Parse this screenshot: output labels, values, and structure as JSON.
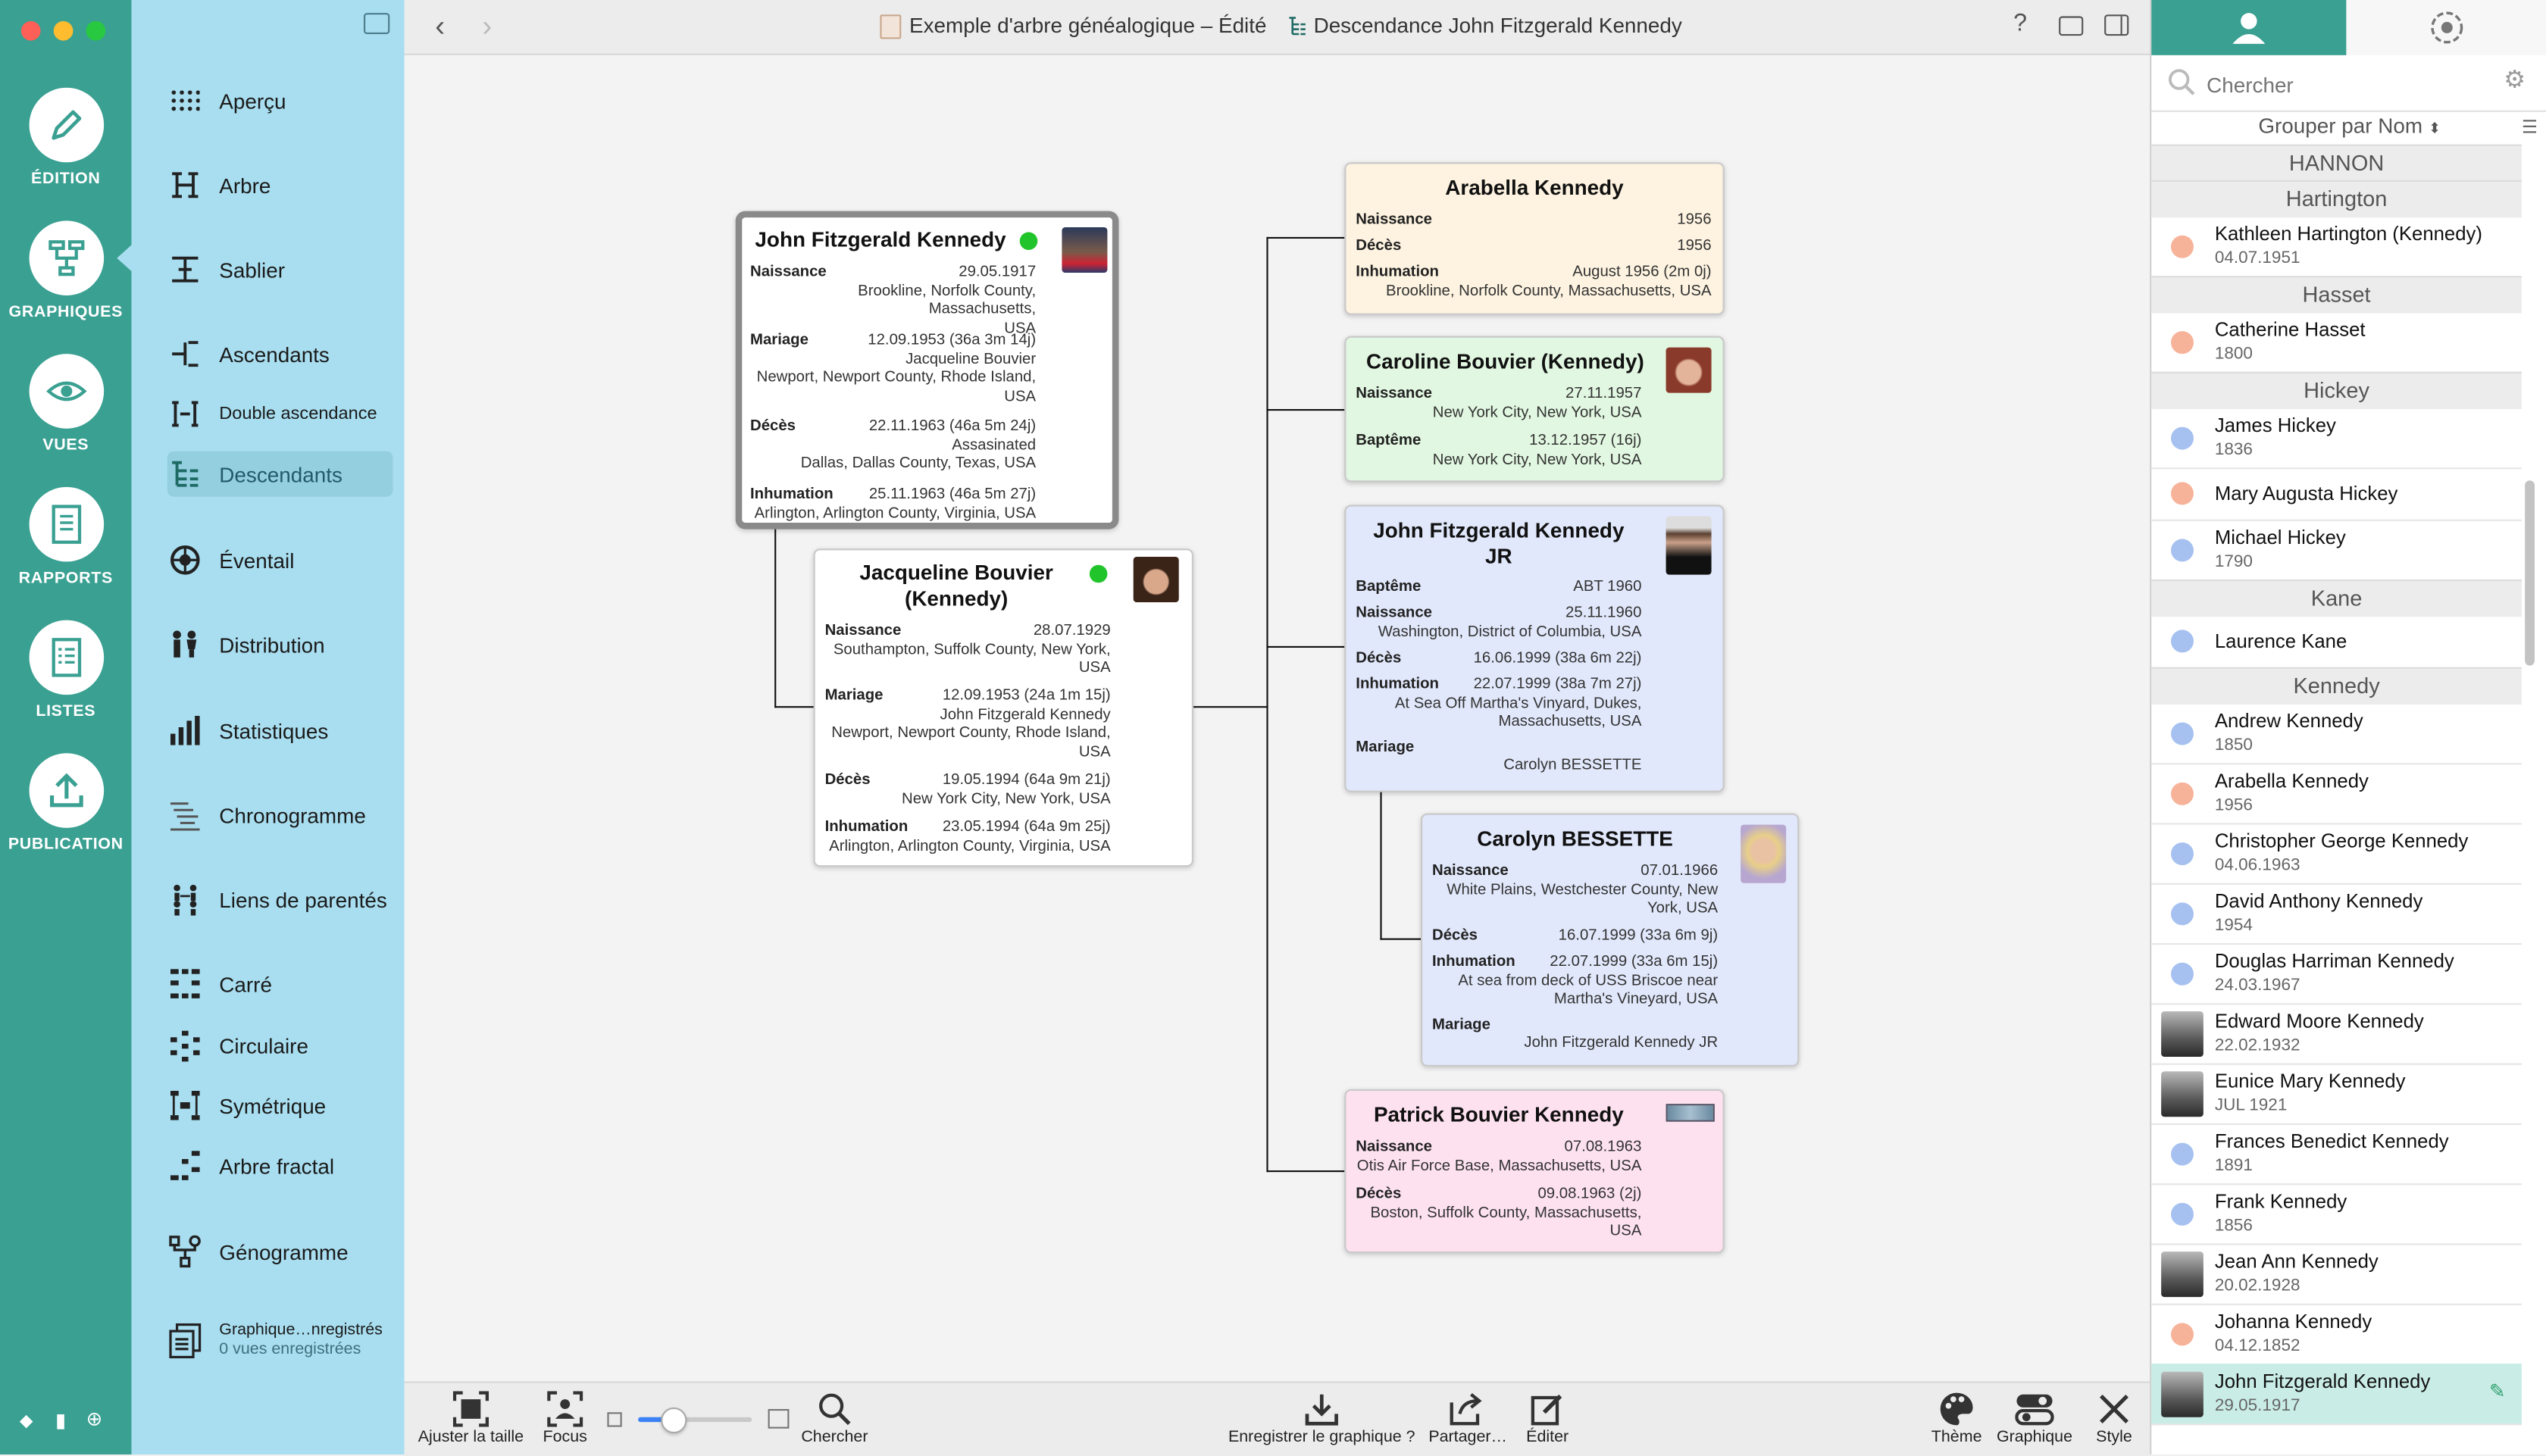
{
  "colors": {
    "rail": "#3aa092",
    "sidebar": "#a8def0",
    "dot_green": "#22c42b",
    "dot_blue": "#a6c1f0",
    "dot_orange": "#f7b39a"
  },
  "rail": {
    "items": [
      {
        "label": "ÉDITION",
        "icon": "pencil-icon"
      },
      {
        "label": "GRAPHIQUES",
        "icon": "chart-icon"
      },
      {
        "label": "VUES",
        "icon": "eye-icon"
      },
      {
        "label": "RAPPORTS",
        "icon": "report-icon"
      },
      {
        "label": "LISTES",
        "icon": "list-icon"
      },
      {
        "label": "PUBLICATION",
        "icon": "upload-icon"
      }
    ]
  },
  "sidebar": {
    "items": [
      {
        "label": "Aperçu"
      },
      {
        "label": "Arbre"
      },
      {
        "label": "Sablier"
      },
      {
        "label": "Ascendants"
      },
      {
        "label": "Double ascendance"
      },
      {
        "label": "Descendants"
      },
      {
        "label": "Éventail"
      },
      {
        "label": "Distribution"
      },
      {
        "label": "Statistiques"
      },
      {
        "label": "Chronogramme"
      },
      {
        "label": "Liens de parentés"
      },
      {
        "label": "Carré"
      },
      {
        "label": "Circulaire"
      },
      {
        "label": "Symétrique"
      },
      {
        "label": "Arbre fractal"
      },
      {
        "label": "Génogramme"
      }
    ],
    "saved": {
      "title": "Graphique…nregistrés",
      "subtitle": "0 vues enregistrées"
    }
  },
  "titlebar": {
    "document": "Exemple d'arbre généalogique – Édité",
    "chart": "Descendance John Fitzgerald Kennedy"
  },
  "toolbar": {
    "fit": "Ajuster la taille",
    "focus": "Focus",
    "search": "Chercher",
    "save": "Enregistrer le graphique ?",
    "share": "Partager…",
    "edit": "Éditer",
    "theme": "Thème",
    "chart": "Graphique",
    "style": "Style",
    "zoom_level": 0.3
  },
  "cards": {
    "jfk": {
      "name": "John Fitzgerald Kennedy",
      "events": [
        {
          "label": "Naissance",
          "lines": [
            "29.05.1917",
            "Brookline, Norfolk County, Massachusetts,",
            "USA"
          ]
        },
        {
          "label": "Mariage",
          "lines": [
            "12.09.1953 (36a 3m 14j)",
            "Jacqueline Bouvier",
            "Newport, Newport County, Rhode Island,",
            "USA"
          ]
        },
        {
          "label": "Décès",
          "lines": [
            "22.11.1963 (46a 5m 24j)",
            "Assasinated",
            "Dallas, Dallas County, Texas, USA"
          ]
        },
        {
          "label": "Inhumation",
          "lines": [
            "25.11.1963 (46a 5m 27j)",
            "Arlington, Arlington County, Virginia, USA"
          ]
        }
      ]
    },
    "jackie": {
      "name": "Jacqueline Bouvier (Kennedy)",
      "events": [
        {
          "label": "Naissance",
          "lines": [
            "28.07.1929",
            "Southampton, Suffolk County, New York,",
            "USA"
          ]
        },
        {
          "label": "Mariage",
          "lines": [
            "12.09.1953 (24a 1m 15j)",
            "John Fitzgerald Kennedy",
            "Newport, Newport County, Rhode Island,",
            "USA"
          ]
        },
        {
          "label": "Décès",
          "lines": [
            "19.05.1994 (64a 9m 21j)",
            "New York City, New York, USA"
          ]
        },
        {
          "label": "Inhumation",
          "lines": [
            "23.05.1994 (64a 9m 25j)",
            "Arlington, Arlington County, Virginia, USA"
          ]
        }
      ]
    },
    "arabella": {
      "name": "Arabella Kennedy",
      "events": [
        {
          "label": "Naissance",
          "lines": [
            "1956"
          ]
        },
        {
          "label": "Décès",
          "lines": [
            "1956"
          ]
        },
        {
          "label": "Inhumation",
          "lines": [
            "August 1956 (2m 0j)",
            "Brookline, Norfolk County, Massachusetts, USA"
          ]
        }
      ]
    },
    "caroline": {
      "name": "Caroline Bouvier (Kennedy)",
      "events": [
        {
          "label": "Naissance",
          "lines": [
            "27.11.1957",
            "New York City, New York, USA"
          ]
        },
        {
          "label": "Baptême",
          "lines": [
            "13.12.1957 (16j)",
            "New York City, New York, USA"
          ]
        }
      ]
    },
    "jfkjr": {
      "name": "John Fitzgerald Kennedy JR",
      "events": [
        {
          "label": "Baptême",
          "lines": [
            "ABT 1960"
          ]
        },
        {
          "label": "Naissance",
          "lines": [
            "25.11.1960",
            "Washington, District of Columbia, USA"
          ]
        },
        {
          "label": "Décès",
          "lines": [
            "16.06.1999 (38a 6m 22j)"
          ]
        },
        {
          "label": "Inhumation",
          "lines": [
            "22.07.1999 (38a 7m 27j)",
            "At Sea Off Martha's Vinyard, Dukes,",
            "Massachusetts, USA"
          ]
        },
        {
          "label": "Mariage",
          "lines": [
            "",
            "Carolyn BESSETTE"
          ]
        }
      ]
    },
    "carolyn": {
      "name": "Carolyn BESSETTE",
      "events": [
        {
          "label": "Naissance",
          "lines": [
            "07.01.1966",
            "White Plains, Westchester County, New",
            "York, USA"
          ]
        },
        {
          "label": "Décès",
          "lines": [
            "16.07.1999 (33a 6m 9j)"
          ]
        },
        {
          "label": "Inhumation",
          "lines": [
            "22.07.1999 (33a 6m 15j)",
            "At sea from deck of USS Briscoe near",
            "Martha's Vineyard, USA"
          ]
        },
        {
          "label": "Mariage",
          "lines": [
            "",
            "John Fitzgerald Kennedy JR"
          ]
        }
      ]
    },
    "patrick": {
      "name": "Patrick Bouvier Kennedy",
      "events": [
        {
          "label": "Naissance",
          "lines": [
            "07.08.1963",
            "Otis Air Force Base, Massachusetts, USA"
          ]
        },
        {
          "label": "Décès",
          "lines": [
            "09.08.1963 (2j)",
            "Boston, Suffolk County, Massachusetts,",
            "USA"
          ]
        }
      ]
    }
  },
  "right_panel": {
    "search_placeholder": "Chercher",
    "group_by": "Grouper par Nom",
    "groups": [
      {
        "name": "HANNON",
        "people": []
      },
      {
        "name": "Hartington",
        "people": [
          {
            "name": "Kathleen Hartington (Kennedy)",
            "date": "04.07.1951",
            "sex": "f"
          }
        ]
      },
      {
        "name": "Hasset",
        "people": [
          {
            "name": "Catherine Hasset",
            "date": "1800",
            "sex": "f"
          }
        ]
      },
      {
        "name": "Hickey",
        "people": [
          {
            "name": "James Hickey",
            "date": "1836",
            "sex": "m"
          },
          {
            "name": "Mary Augusta Hickey",
            "date": "",
            "sex": "f"
          },
          {
            "name": "Michael Hickey",
            "date": "1790",
            "sex": "m"
          }
        ]
      },
      {
        "name": "Kane",
        "people": [
          {
            "name": "Laurence Kane",
            "date": "",
            "sex": "m"
          }
        ]
      },
      {
        "name": "Kennedy",
        "people": [
          {
            "name": "Andrew Kennedy",
            "date": "1850",
            "sex": "m"
          },
          {
            "name": "Arabella Kennedy",
            "date": "1956",
            "sex": "f"
          },
          {
            "name": "Christopher George Kennedy",
            "date": "04.06.1963",
            "sex": "m"
          },
          {
            "name": "David Anthony Kennedy",
            "date": "1954",
            "sex": "m"
          },
          {
            "name": "Douglas Harriman Kennedy",
            "date": "24.03.1967",
            "sex": "m"
          },
          {
            "name": "Edward Moore Kennedy",
            "date": "22.02.1932",
            "sex": "photo"
          },
          {
            "name": "Eunice Mary Kennedy",
            "date": "JUL 1921",
            "sex": "photo"
          },
          {
            "name": "Frances Benedict Kennedy",
            "date": "1891",
            "sex": "m"
          },
          {
            "name": "Frank Kennedy",
            "date": "1856",
            "sex": "m"
          },
          {
            "name": "Jean Ann Kennedy",
            "date": "20.02.1928",
            "sex": "photo"
          },
          {
            "name": "Johanna Kennedy",
            "date": "04.12.1852",
            "sex": "f"
          },
          {
            "name": "John Fitzgerald Kennedy",
            "date": "29.05.1917",
            "sex": "photo"
          }
        ]
      }
    ]
  }
}
